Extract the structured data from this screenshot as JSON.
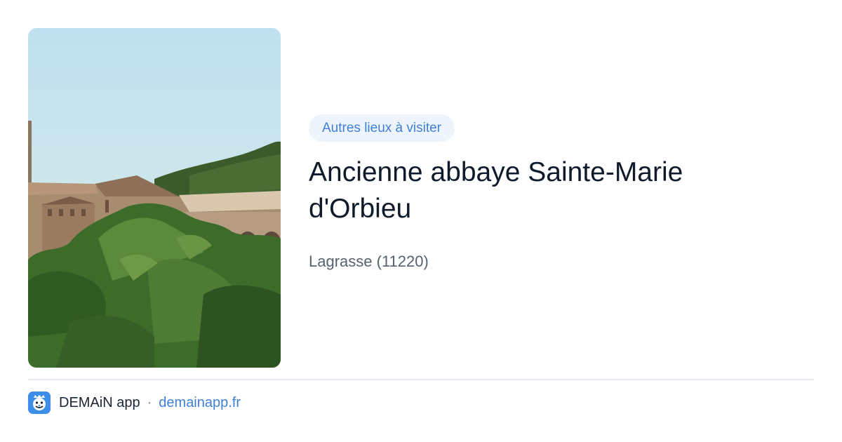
{
  "badge": {
    "label": "Autres lieux à visiter"
  },
  "place": {
    "title": "Ancienne abbaye Sainte-Marie d'Orbieu",
    "location": "Lagrasse (11220)"
  },
  "footer": {
    "app_name": "DEMAiN app",
    "separator": "·",
    "site": "demainapp.fr"
  },
  "colors": {
    "accent": "#3f7fd7",
    "badge_bg": "#eef4fc",
    "title": "#0f1b2b",
    "muted": "#556270"
  },
  "icons": {
    "logo": "demain-app-logo-icon"
  }
}
